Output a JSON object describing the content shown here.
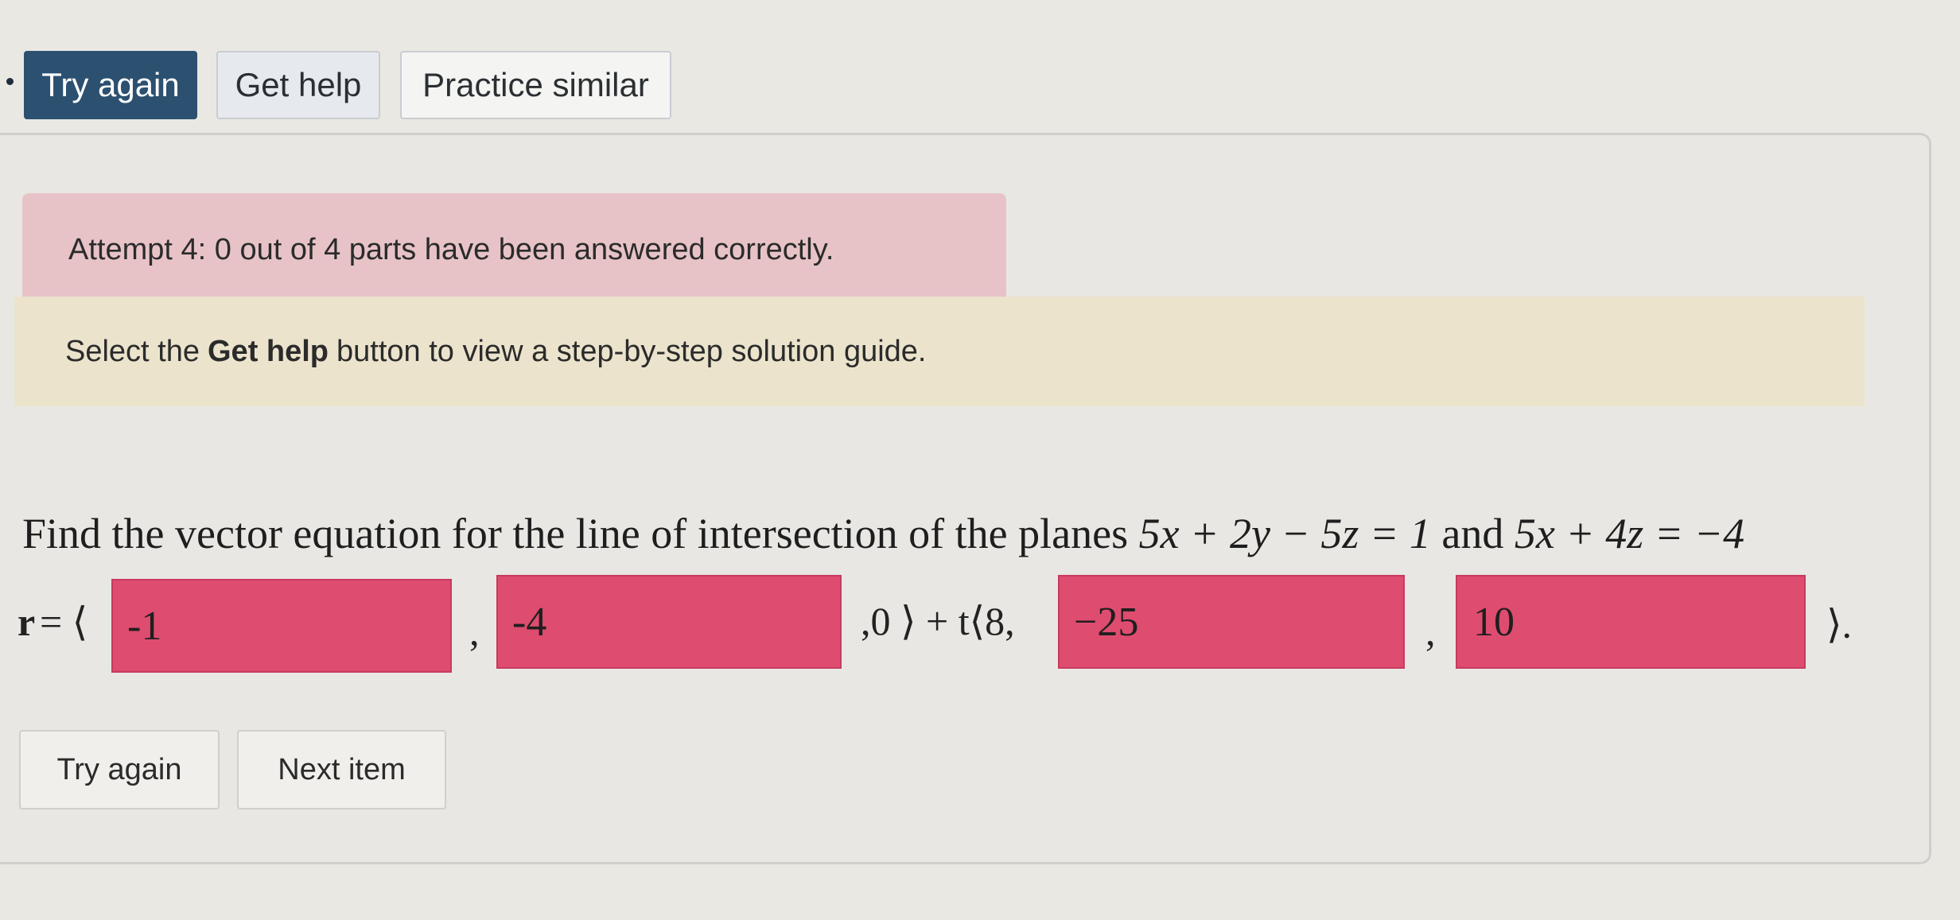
{
  "toolbar": {
    "try_again_label": "Try again",
    "get_help_label": "Get help",
    "practice_similar_label": "Practice similar"
  },
  "status": {
    "attempt_message": "Attempt 4: 0 out of 4 parts have been answered correctly.",
    "help_prefix": "Select the",
    "help_bold": "Get help",
    "help_suffix": "button to view a step-by-step solution guide."
  },
  "question": {
    "prefix": "Find the vector equation for the line of intersection of the planes",
    "plane1": "5x + 2y − 5z = 1",
    "connector": "and",
    "plane2": "5x + 4z = −4"
  },
  "answer": {
    "r_label": "r",
    "equals_open": "= ⟨",
    "field1_value": "-1",
    "comma1": ",",
    "field2_value": "-4",
    "middle": ",0 ⟩ + t⟨8,",
    "field3_value": "−25",
    "comma3": ",",
    "field4_value": "10",
    "close": "⟩."
  },
  "actions": {
    "try_again_label": "Try again",
    "next_item_label": "Next item"
  },
  "colors": {
    "primary_button": "#2c5070",
    "incorrect_field": "#de4c6f",
    "alert_red": "#e7c3c7",
    "alert_yellow": "#ebe3cc"
  }
}
